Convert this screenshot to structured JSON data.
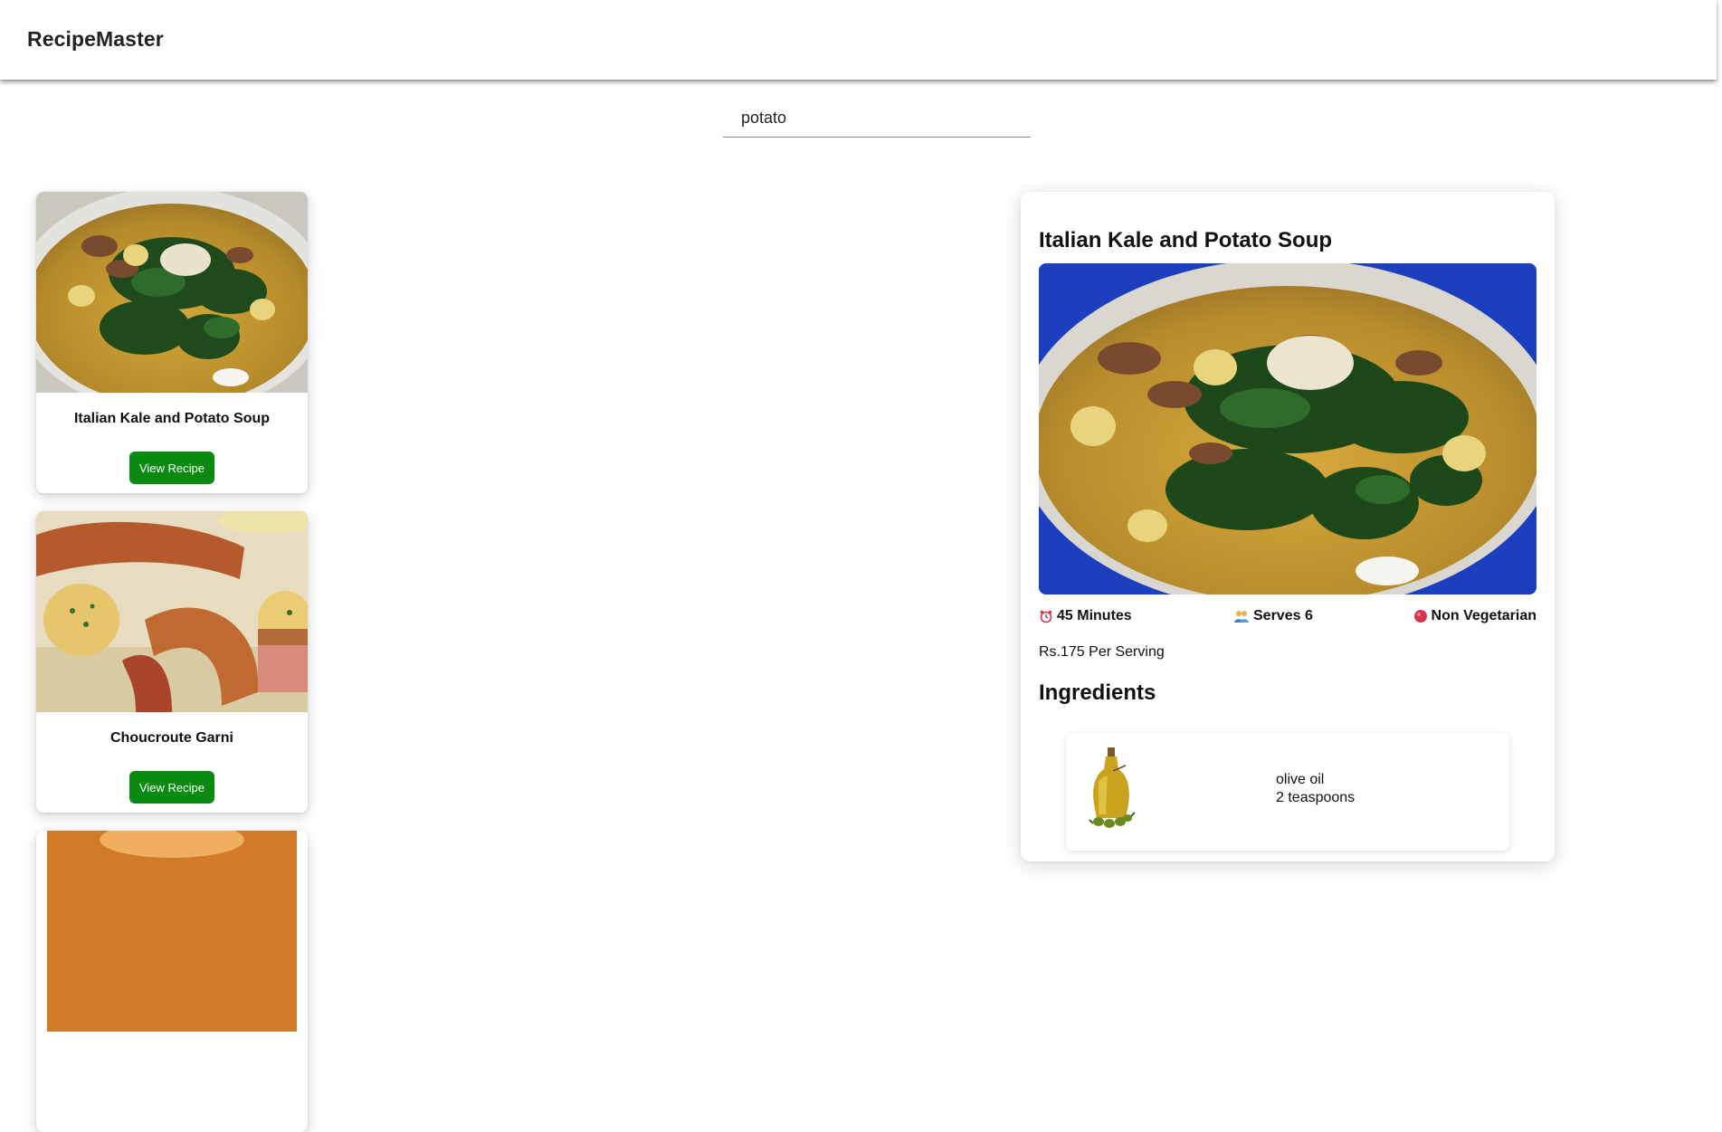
{
  "header": {
    "app_title": "RecipeMaster"
  },
  "search": {
    "value": "potato",
    "placeholder": ""
  },
  "recipes": [
    {
      "name": "Italian Kale and Potato Soup",
      "button_label": "View Recipe"
    },
    {
      "name": "Choucroute Garni",
      "button_label": "View Recipe"
    }
  ],
  "detail": {
    "title": "Italian Kale and Potato Soup",
    "time": "45 Minutes",
    "serves": "Serves 6",
    "diet": "Non Vegetarian",
    "price": "Rs.175 Per Serving",
    "ingredients_heading": "Ingredients",
    "ingredients": [
      {
        "name": "olive oil",
        "quantity": "2 teaspoons"
      }
    ]
  },
  "icons": {
    "time": "alarm-clock-icon",
    "serves": "people-icon",
    "diet": "red-dot-icon"
  },
  "colors": {
    "view_button": "#0a8a11",
    "non_veg_dot": "#d8344f"
  }
}
